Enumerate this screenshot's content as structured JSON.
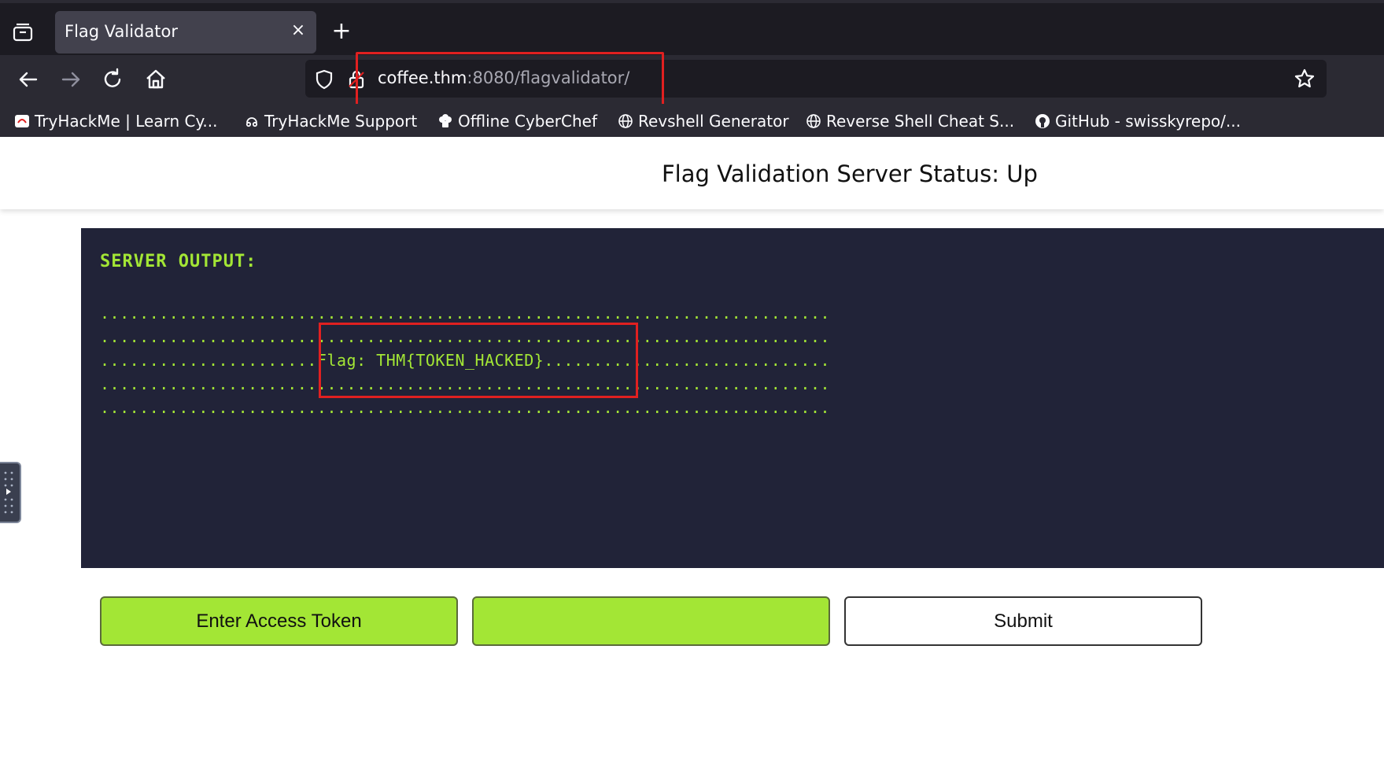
{
  "browser": {
    "tab_title": "Flag Validator",
    "tab_close": "×",
    "new_tab": "+",
    "url_host": "coffee.thm",
    "url_rest": ":8080/flagvalidator/",
    "bookmarks": [
      {
        "label": "TryHackMe | Learn Cy...",
        "icon": "tryhackme-icon"
      },
      {
        "label": "TryHackMe Support",
        "icon": "support-icon"
      },
      {
        "label": "Offline CyberChef",
        "icon": "chef-icon"
      },
      {
        "label": "Revshell Generator",
        "icon": "globe-icon"
      },
      {
        "label": "Reverse Shell Cheat S...",
        "icon": "globe-icon"
      },
      {
        "label": "GitHub - swisskyrepo/...",
        "icon": "github-icon"
      }
    ]
  },
  "page": {
    "title": "Flag Validation Server Status: Up",
    "server_output_label": "SERVER OUTPUT:",
    "output_lines": [
      "..........................................................................",
      "..........................................................................",
      "......................Flag: THM{TOKEN_HACKED}.............................",
      "..........................................................................",
      ".........................................................................."
    ],
    "buttons": {
      "enter_token": "Enter Access Token",
      "token_value": "",
      "submit": "Submit"
    }
  },
  "colors": {
    "accent": "#a3e635",
    "panel_bg": "#212338",
    "highlight_box": "#e02020"
  }
}
